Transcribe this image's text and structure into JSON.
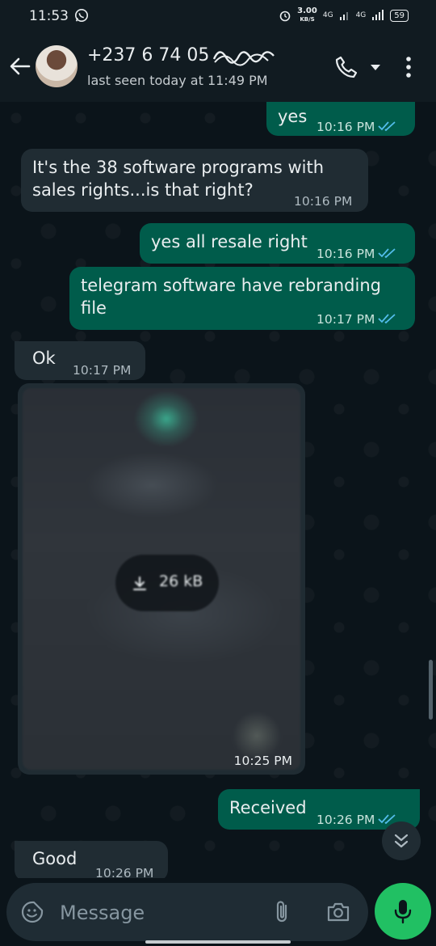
{
  "status_bar": {
    "time": "11:53",
    "speed_value": "3.00",
    "speed_unit": "KB/S",
    "network_1": "4G",
    "network_2": "4G",
    "battery": "59"
  },
  "header": {
    "contact_name": "+237 6 74 05",
    "last_seen": "last seen today at 11:49 PM"
  },
  "messages": [
    {
      "direction": "out",
      "text": "yes",
      "time": "10:16 PM",
      "read": true
    },
    {
      "direction": "in",
      "text": "It's the 38 software programs with sales rights...is that right?",
      "time": "10:16 PM"
    },
    {
      "direction": "out",
      "text": "yes all resale right",
      "time": "10:16 PM",
      "read": true
    },
    {
      "direction": "out",
      "text": "telegram software have rebranding file",
      "time": "10:17 PM",
      "read": true
    },
    {
      "direction": "in",
      "text": "Ok",
      "time": "10:17 PM"
    },
    {
      "direction": "in",
      "type": "image",
      "download_size": "26 kB",
      "time": "10:25 PM"
    },
    {
      "direction": "out",
      "text": "Received",
      "time": "10:26 PM",
      "read": true
    },
    {
      "direction": "in",
      "text": "Good",
      "time": "10:26 PM"
    }
  ],
  "composer": {
    "placeholder": "Message"
  },
  "colors": {
    "incoming_bubble": "#202c33",
    "outgoing_bubble": "#005c4b",
    "read_ticks": "#53bdeb",
    "mic_button": "#21c063"
  }
}
